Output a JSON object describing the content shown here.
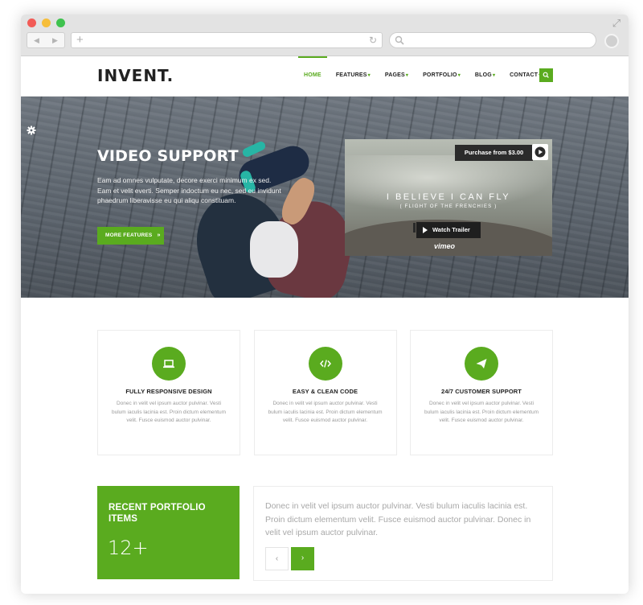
{
  "colors": {
    "accent": "#5aab1f",
    "hero_overlay": "#5d656e",
    "text_muted": "#9a9a9a"
  },
  "browser": {
    "back_icon": "arrow-left-icon",
    "forward_icon": "arrow-right-icon",
    "new_tab_icon": "plus-icon",
    "reload_icon": "reload-icon",
    "search_icon": "search-icon"
  },
  "header": {
    "logo": "INVENT.",
    "menu": [
      {
        "label": "HOME",
        "dropdown": false,
        "active": true
      },
      {
        "label": "FEATURES",
        "dropdown": true
      },
      {
        "label": "PAGES",
        "dropdown": true
      },
      {
        "label": "PORTFOLIO",
        "dropdown": true
      },
      {
        "label": "BLOG",
        "dropdown": true
      },
      {
        "label": "CONTACT",
        "dropdown": true
      }
    ]
  },
  "hero": {
    "title": "VIDEO SUPPORT",
    "text": "Eam ad omnes vulputate, decore exerci minimum ex sed. Eam et velit everti. Semper indoctum eu nec, sed eu invidunt phaedrum liberavisse eu qui aliqu constituam.",
    "button": "MORE FEATURES",
    "video": {
      "purchase": "Purchase from $3.00",
      "title": "I BELIEVE I CAN FLY",
      "subtitle": "( FLIGHT OF THE FRENCHIES )",
      "trailer": "Watch Trailer",
      "brand": "vimeo"
    }
  },
  "features": [
    {
      "icon": "laptop-icon",
      "title": "FULLY RESPONSIVE DESIGN",
      "text": "Donec in velit vel ipsum auctor pulvinar. Vesti bulum iaculis lacinia est. Proin dictum elementum velit. Fusce euismod auctor pulvinar."
    },
    {
      "icon": "code-icon",
      "title": "EASY & CLEAN CODE",
      "text": "Donec in velit vel ipsum auctor pulvinar. Vesti bulum iaculis lacinia est. Proin dictum elementum velit. Fusce euismod auctor pulvinar."
    },
    {
      "icon": "paper-plane-icon",
      "title": "24/7 CUSTOMER SUPPORT",
      "text": "Donec in velit vel ipsum auctor pulvinar. Vesti bulum iaculis lacinia est. Proin dictum elementum velit. Fusce euismod auctor pulvinar."
    }
  ],
  "portfolio": {
    "title": "RECENT PORTFOLIO ITEMS",
    "count": "12+",
    "text": "Donec in velit vel ipsum auctor pulvinar. Vesti bulum iaculis lacinia est. Proin dictum elementum velit. Fusce euismod auctor pulvinar. Donec in velit vel ipsum auctor pulvinar.",
    "prev": "‹",
    "next": "›"
  }
}
